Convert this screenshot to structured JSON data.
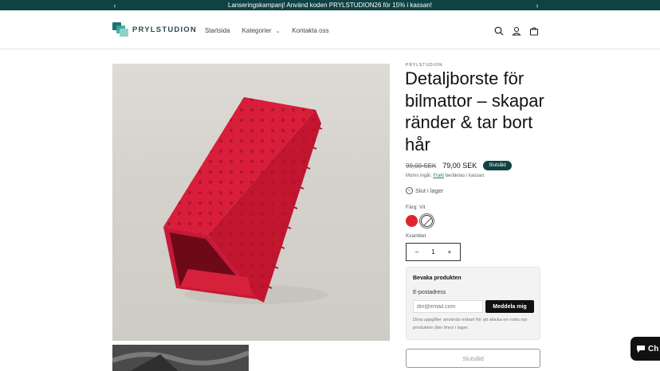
{
  "announcement": {
    "text": "Lanseringskampanj! Använd koden PRYLSTUDION26 för 15% i kassan!"
  },
  "header": {
    "logo_text": "PRYLSTUDION",
    "nav": [
      {
        "label": "Startsida"
      },
      {
        "label": "Kategorier",
        "has_dropdown": true
      },
      {
        "label": "Kontakta oss"
      }
    ],
    "icons": [
      "search-icon",
      "account-icon",
      "cart-icon"
    ]
  },
  "product": {
    "vendor": "PRYLSTUDION",
    "title": "Detaljborste för bilmattor – skapar ränder & tar bort hår",
    "old_price": "99,00 SEK",
    "price": "79,00 SEK",
    "badge": "Slutsåld",
    "tax_prefix": "Moms ingår. ",
    "tax_link": "Frakt",
    "tax_suffix": " beräknas i kassan.",
    "stock": "Slut i lager",
    "color_label": "Färg: Vit",
    "swatches": [
      {
        "name": "Röd",
        "color": "#e0242c"
      },
      {
        "name": "Vit",
        "color": "#ffffff",
        "selected": true,
        "sold_out": true
      }
    ],
    "quantity_label": "Kvantitet",
    "quantity": "1",
    "sold_out_button": "Slutsåld"
  },
  "notify": {
    "title": "Bevaka produkten",
    "email_label": "E-postadress",
    "email_placeholder": "din@email.com",
    "button": "Meddela mig",
    "note": "Dina uppgifter används enbart för att skicka en notis när produkten åter finns i lager."
  },
  "chat": {
    "label": "Ch"
  },
  "colors": {
    "brand": "#0f4343",
    "product_red": "#e0242c"
  }
}
